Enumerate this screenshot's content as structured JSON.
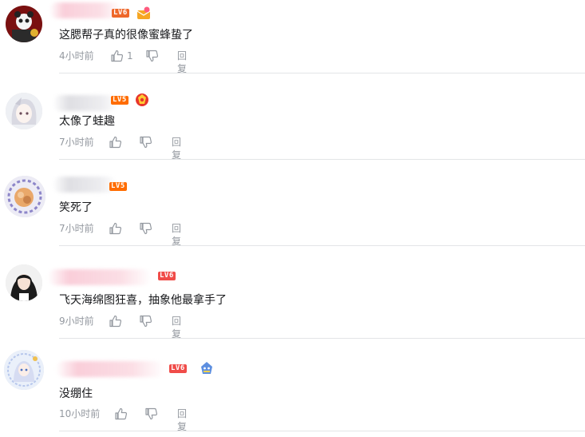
{
  "comments": [
    {
      "level": "LV6",
      "text": "这腮帮子真的很像蜜蜂蛰了",
      "time": "4小时前",
      "likes": "1",
      "reply": "回复"
    },
    {
      "level": "LV5",
      "text": "太像了蛙趣",
      "time": "7小时前",
      "likes": "",
      "reply": "回复"
    },
    {
      "level": "LV5",
      "text": "笑死了",
      "time": "7小时前",
      "likes": "",
      "reply": "回复"
    },
    {
      "level": "LV6",
      "text": "飞天海绵图狂喜，抽象他最拿手了",
      "time": "9小时前",
      "likes": "",
      "reply": "回复"
    },
    {
      "level": "LV6",
      "text": "没绷住",
      "time": "10小时前",
      "likes": "",
      "reply": "回复"
    }
  ],
  "colors": {
    "text": "#18191c",
    "meta": "#9499a0",
    "divider": "#e3e5e7",
    "level_orange": "#ff6c00",
    "level_red": "#f04c49"
  }
}
